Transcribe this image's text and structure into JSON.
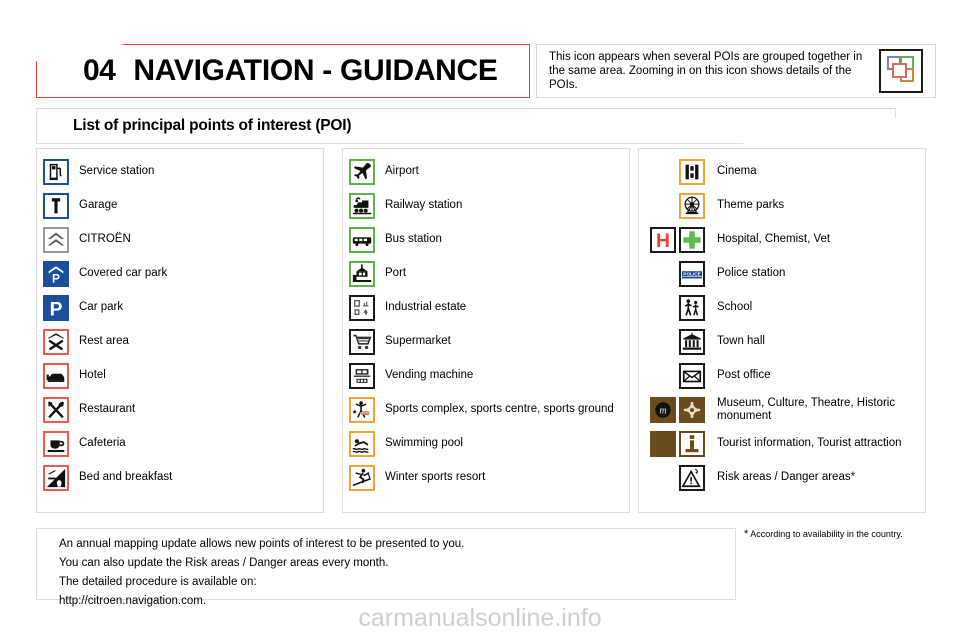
{
  "header": {
    "chapter_number": "04",
    "chapter_title": "NAVIGATION - GUIDANCE",
    "info_text": "This icon appears when several POIs are grouped together in the same area. Zooming in on this icon shows details of the POIs.",
    "group_icon_name": "grouped-pois-icon"
  },
  "subtitle": "List of principal points of interest (POI)",
  "columns": [
    {
      "id": "column-1",
      "items": [
        {
          "label": "Service station",
          "icons": [
            "fuel-pump-icon"
          ]
        },
        {
          "label": "Garage",
          "icons": [
            "wrench-icon"
          ]
        },
        {
          "label": "CITROËN",
          "icons": [
            "citroen-chevrons-icon"
          ]
        },
        {
          "label": "Covered car park",
          "icons": [
            "covered-parking-icon"
          ]
        },
        {
          "label": "Car park",
          "icons": [
            "parking-icon"
          ]
        },
        {
          "label": "Rest area",
          "icons": [
            "rest-area-icon"
          ]
        },
        {
          "label": "Hotel",
          "icons": [
            "bed-icon"
          ]
        },
        {
          "label": "Restaurant",
          "icons": [
            "cutlery-icon"
          ]
        },
        {
          "label": "Cafeteria",
          "icons": [
            "coffee-cup-icon"
          ]
        },
        {
          "label": "Bed and breakfast",
          "icons": [
            "bed-and-breakfast-icon"
          ]
        }
      ]
    },
    {
      "id": "column-2",
      "items": [
        {
          "label": "Airport",
          "icons": [
            "airplane-icon"
          ]
        },
        {
          "label": "Railway station",
          "icons": [
            "train-icon"
          ]
        },
        {
          "label": "Bus station",
          "icons": [
            "bus-icon"
          ]
        },
        {
          "label": "Port",
          "icons": [
            "ship-icon"
          ]
        },
        {
          "label": "Industrial estate",
          "icons": [
            "industrial-estate-icon"
          ]
        },
        {
          "label": "Supermarket",
          "icons": [
            "shopping-cart-icon"
          ]
        },
        {
          "label": "Vending machine",
          "icons": [
            "vending-machine-icon"
          ]
        },
        {
          "label": "Sports complex, sports centre, sports ground",
          "icons": [
            "sports-complex-icon"
          ]
        },
        {
          "label": "Swimming pool",
          "icons": [
            "swimmer-icon"
          ]
        },
        {
          "label": "Winter sports resort",
          "icons": [
            "skier-icon"
          ]
        }
      ]
    },
    {
      "id": "column-3",
      "items": [
        {
          "label": "Cinema",
          "icons": [
            "film-reel-icon"
          ]
        },
        {
          "label": "Theme parks",
          "icons": [
            "ferris-wheel-icon"
          ]
        },
        {
          "label": "Hospital, Chemist, Vet",
          "icons": [
            "hospital-h-icon",
            "green-cross-icon"
          ]
        },
        {
          "label": "Police station",
          "icons": [
            "police-icon"
          ]
        },
        {
          "label": "School",
          "icons": [
            "school-children-icon"
          ]
        },
        {
          "label": "Town hall",
          "icons": [
            "town-hall-icon"
          ]
        },
        {
          "label": "Post office",
          "icons": [
            "envelope-icon"
          ]
        },
        {
          "label": "Museum, Culture, Theatre, Historic monument",
          "icons": [
            "museum-m-icon",
            "historic-monument-icon"
          ]
        },
        {
          "label": "Tourist information, Tourist attraction",
          "icons": [
            "tourist-attraction-icon",
            "information-i-icon"
          ]
        },
        {
          "label": "Risk areas / Danger areas*",
          "icons": [
            "danger-warning-icon"
          ]
        }
      ]
    }
  ],
  "bottom_note": {
    "lines": [
      "An annual mapping update allows new points of interest to be presented to you.",
      "You can also update the Risk areas / Danger areas every month.",
      "The detailed procedure is available on:",
      "http://citroen.navigation.com."
    ]
  },
  "footnote": {
    "marker": "*",
    "text": "According to availability in the country."
  },
  "watermark": "carmanualsonline.info",
  "colors": {
    "accent_red": "#e8403a",
    "blue_sign": "#1b4f9c",
    "red_sign": "#ef5a4e",
    "green_sign": "#63b04e",
    "orange_sign": "#f0a33c",
    "black_sign": "#1a1a1a",
    "brown_sign": "#6b4c1e",
    "hospital_red": "#ef3b33",
    "chemist_green": "#5fbb4e",
    "watermark_grey": "#cfcfcf"
  }
}
